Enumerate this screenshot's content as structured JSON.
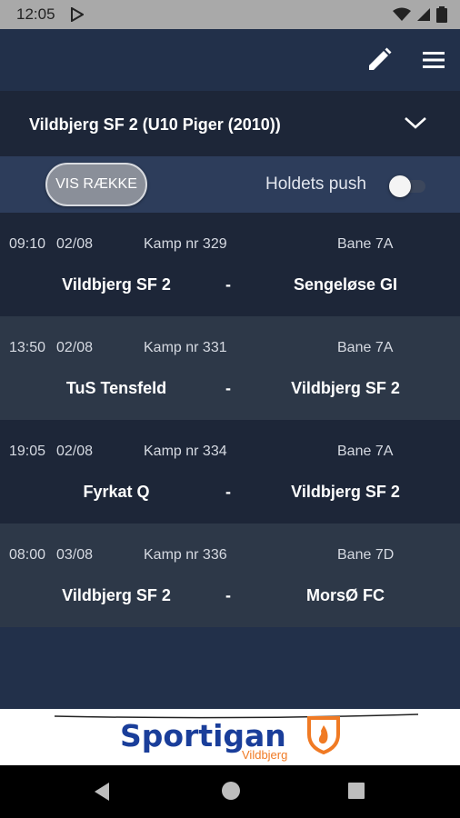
{
  "status_bar": {
    "time": "12:05"
  },
  "header": {
    "team_title": "Vildbjerg SF 2 (U10 Piger (2010))"
  },
  "controls": {
    "vis_button": "VIS RÆKKE",
    "push_label": "Holdets push",
    "push_enabled": false
  },
  "matches": [
    {
      "time": "09:10",
      "date": "02/08",
      "kamp": "Kamp nr 329",
      "bane": "Bane 7A",
      "home": "Vildbjerg SF 2",
      "sep": "-",
      "away": "Sengeløse GI"
    },
    {
      "time": "13:50",
      "date": "02/08",
      "kamp": "Kamp nr 331",
      "bane": "Bane 7A",
      "home": "TuS Tensfeld",
      "sep": "-",
      "away": "Vildbjerg SF 2"
    },
    {
      "time": "19:05",
      "date": "02/08",
      "kamp": "Kamp nr 334",
      "bane": "Bane 7A",
      "home": "Fyrkat Q",
      "sep": "-",
      "away": "Vildbjerg SF 2"
    },
    {
      "time": "08:00",
      "date": "03/08",
      "kamp": "Kamp nr 336",
      "bane": "Bane 7D",
      "home": "Vildbjerg SF 2",
      "sep": "-",
      "away": "MorsØ FC"
    }
  ],
  "ad": {
    "brand": "Sportigan",
    "sub": "Vildbjerg"
  },
  "colors": {
    "app_bg": "#22304a",
    "row_dark": "#1d2638",
    "row_light": "#2d3848",
    "controls_bg": "#2d3d5b",
    "brand_blue": "#1a3e9a",
    "brand_orange": "#f07a24"
  }
}
